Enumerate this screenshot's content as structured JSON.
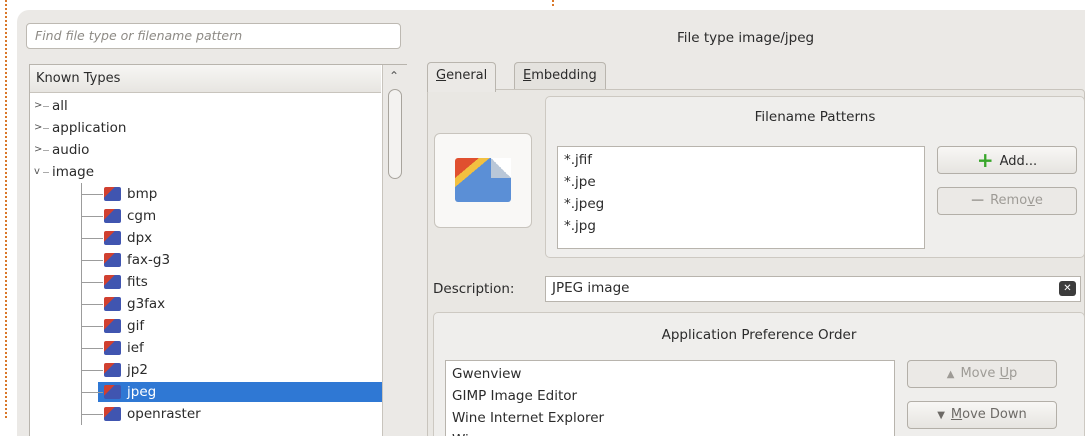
{
  "search": {
    "placeholder": "Find file type or filename pattern"
  },
  "tree": {
    "header": "Known Types",
    "top_items": [
      {
        "label": "all",
        "expander": ">"
      },
      {
        "label": "application",
        "expander": ">"
      },
      {
        "label": "audio",
        "expander": ">"
      },
      {
        "label": "image",
        "expander": "v"
      }
    ],
    "image_children": [
      "bmp",
      "cgm",
      "dpx",
      "fax-g3",
      "fits",
      "g3fax",
      "gif",
      "ief",
      "jp2",
      "jpeg",
      "openraster"
    ],
    "selected": "jpeg"
  },
  "detail": {
    "title": "File type image/jpeg",
    "tabs": {
      "general": "General",
      "embedding": "Embedding"
    },
    "filename_patterns": {
      "title": "Filename Patterns",
      "patterns": [
        "*.jfif",
        "*.jpe",
        "*.jpeg",
        "*.jpg"
      ],
      "add_label": "Add...",
      "remove_label": "Remove"
    },
    "description": {
      "label": "Description:",
      "value": "JPEG image"
    },
    "app_pref": {
      "title": "Application Preference Order",
      "apps": [
        "Gwenview",
        "GIMP Image Editor",
        "Wine Internet Explorer",
        "Wine exec.exe"
      ],
      "move_up_label": "Move Up",
      "move_down_label": "Move Down"
    }
  },
  "colors": {
    "selection": "#2f78d4",
    "add_icon": "#39a62b",
    "window_bg": "#ebe9e6"
  }
}
